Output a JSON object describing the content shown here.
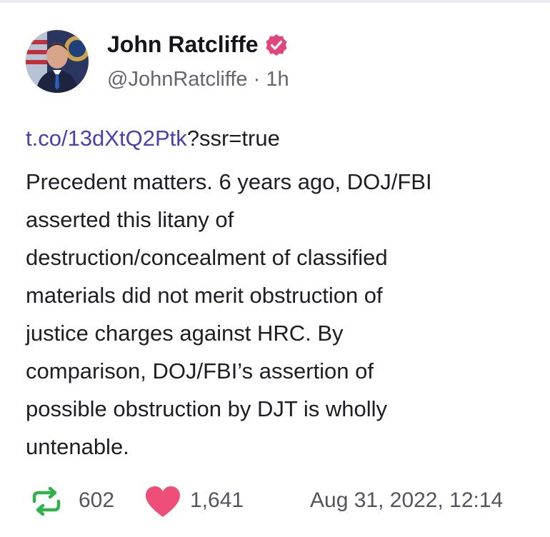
{
  "post": {
    "author_name": "John Ratcliffe",
    "handle": "@JohnRatcliffe",
    "separator": "·",
    "age": "1h",
    "link_text": "t.co/13dXtQ2Ptk",
    "link_suffix": "?ssr=true",
    "body": "Precedent matters. 6 years ago, DOJ/FBI\nasserted this litany of\ndestruction/concealment of classified\nmaterials did not merit obstruction of\njustice charges against HRC. By\ncomparison, DOJ/FBI’s assertion of\npossible obstruction by DJT is wholly\nuntenable."
  },
  "footer": {
    "retweet_count": "602",
    "like_count": "1,641",
    "timestamp": "Aug 31, 2022, 12:14"
  },
  "icons": {
    "verified": "verified-badge-icon",
    "retweet": "retweet-icon",
    "like": "heart-icon"
  },
  "colors": {
    "link": "#4b3fb0",
    "verified_badge": "#e0457b",
    "retweet": "#2fb24c",
    "heart": "#ee4f78",
    "muted_text": "#67646f"
  }
}
